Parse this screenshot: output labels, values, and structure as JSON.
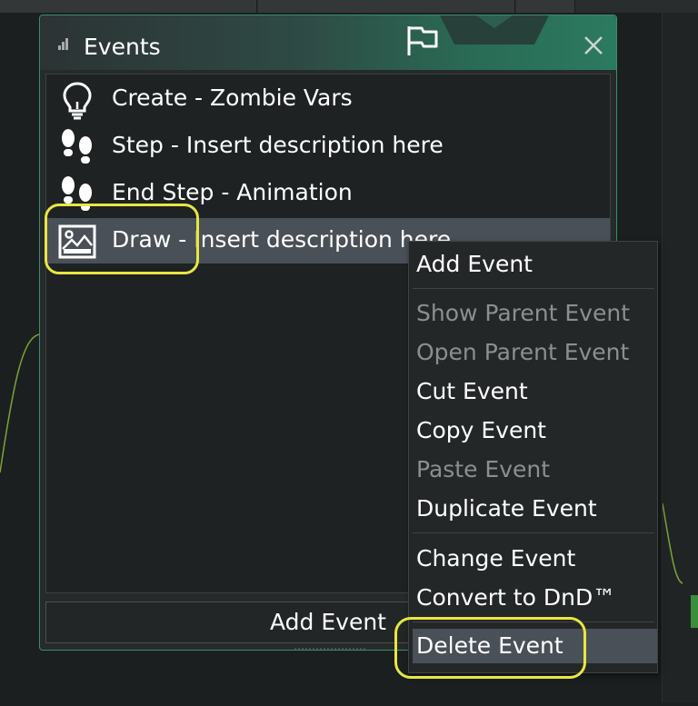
{
  "window": {
    "title": "Events"
  },
  "background": {
    "tabs": [
      "",
      ""
    ]
  },
  "events": [
    {
      "label": "Create - Zombie Vars",
      "icon": "lightbulb-icon"
    },
    {
      "label": "Step - Insert description here",
      "icon": "footsteps-icon"
    },
    {
      "label": "End Step - Animation",
      "icon": "footsteps-icon"
    },
    {
      "label": "Draw - Insert description here",
      "icon": "image-icon",
      "selected": true
    }
  ],
  "add_event_label": "Add Event",
  "context_menu": {
    "items": [
      {
        "label": "Add Event",
        "enabled": true
      },
      {
        "label": "Show Parent Event",
        "enabled": false
      },
      {
        "label": "Open Parent Event",
        "enabled": false
      },
      {
        "label": "Cut Event",
        "enabled": true
      },
      {
        "label": "Copy Event",
        "enabled": true
      },
      {
        "label": "Paste Event",
        "enabled": false
      },
      {
        "label": "Duplicate Event",
        "enabled": true
      },
      {
        "label": "Change Event",
        "enabled": true
      },
      {
        "label": "Convert to DnD™",
        "enabled": true
      },
      {
        "label": "Delete Event",
        "enabled": true,
        "active": true
      }
    ]
  },
  "colors": {
    "highlight": "#e8e641",
    "accent": "#2b7a5f",
    "selected_row": "#4a5057"
  }
}
